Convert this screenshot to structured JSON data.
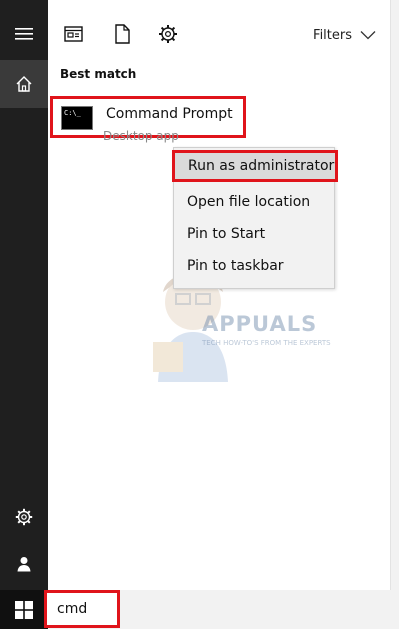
{
  "toolbar": {
    "filters_label": "Filters",
    "icons": [
      "apps-icon",
      "documents-icon",
      "settings-icon"
    ]
  },
  "results": {
    "section_title": "Best match",
    "best_match": {
      "title": "Command Prompt",
      "subtitle": "Desktop app",
      "icon": "command-prompt-icon",
      "icon_text": "C:\\_"
    }
  },
  "context_menu": {
    "items": [
      {
        "label": "Run as administrator"
      },
      {
        "label": "Open file location"
      },
      {
        "label": "Pin to Start"
      },
      {
        "label": "Pin to taskbar"
      }
    ]
  },
  "watermark": {
    "brand": "APPUALS",
    "tagline": "TECH HOW-TO'S FROM THE EXPERTS"
  },
  "search": {
    "value": "cmd"
  },
  "colors": {
    "highlight_border": "#e0141b",
    "rail_bg": "#1f1f1f",
    "menu_bg": "#f2f2f2"
  }
}
